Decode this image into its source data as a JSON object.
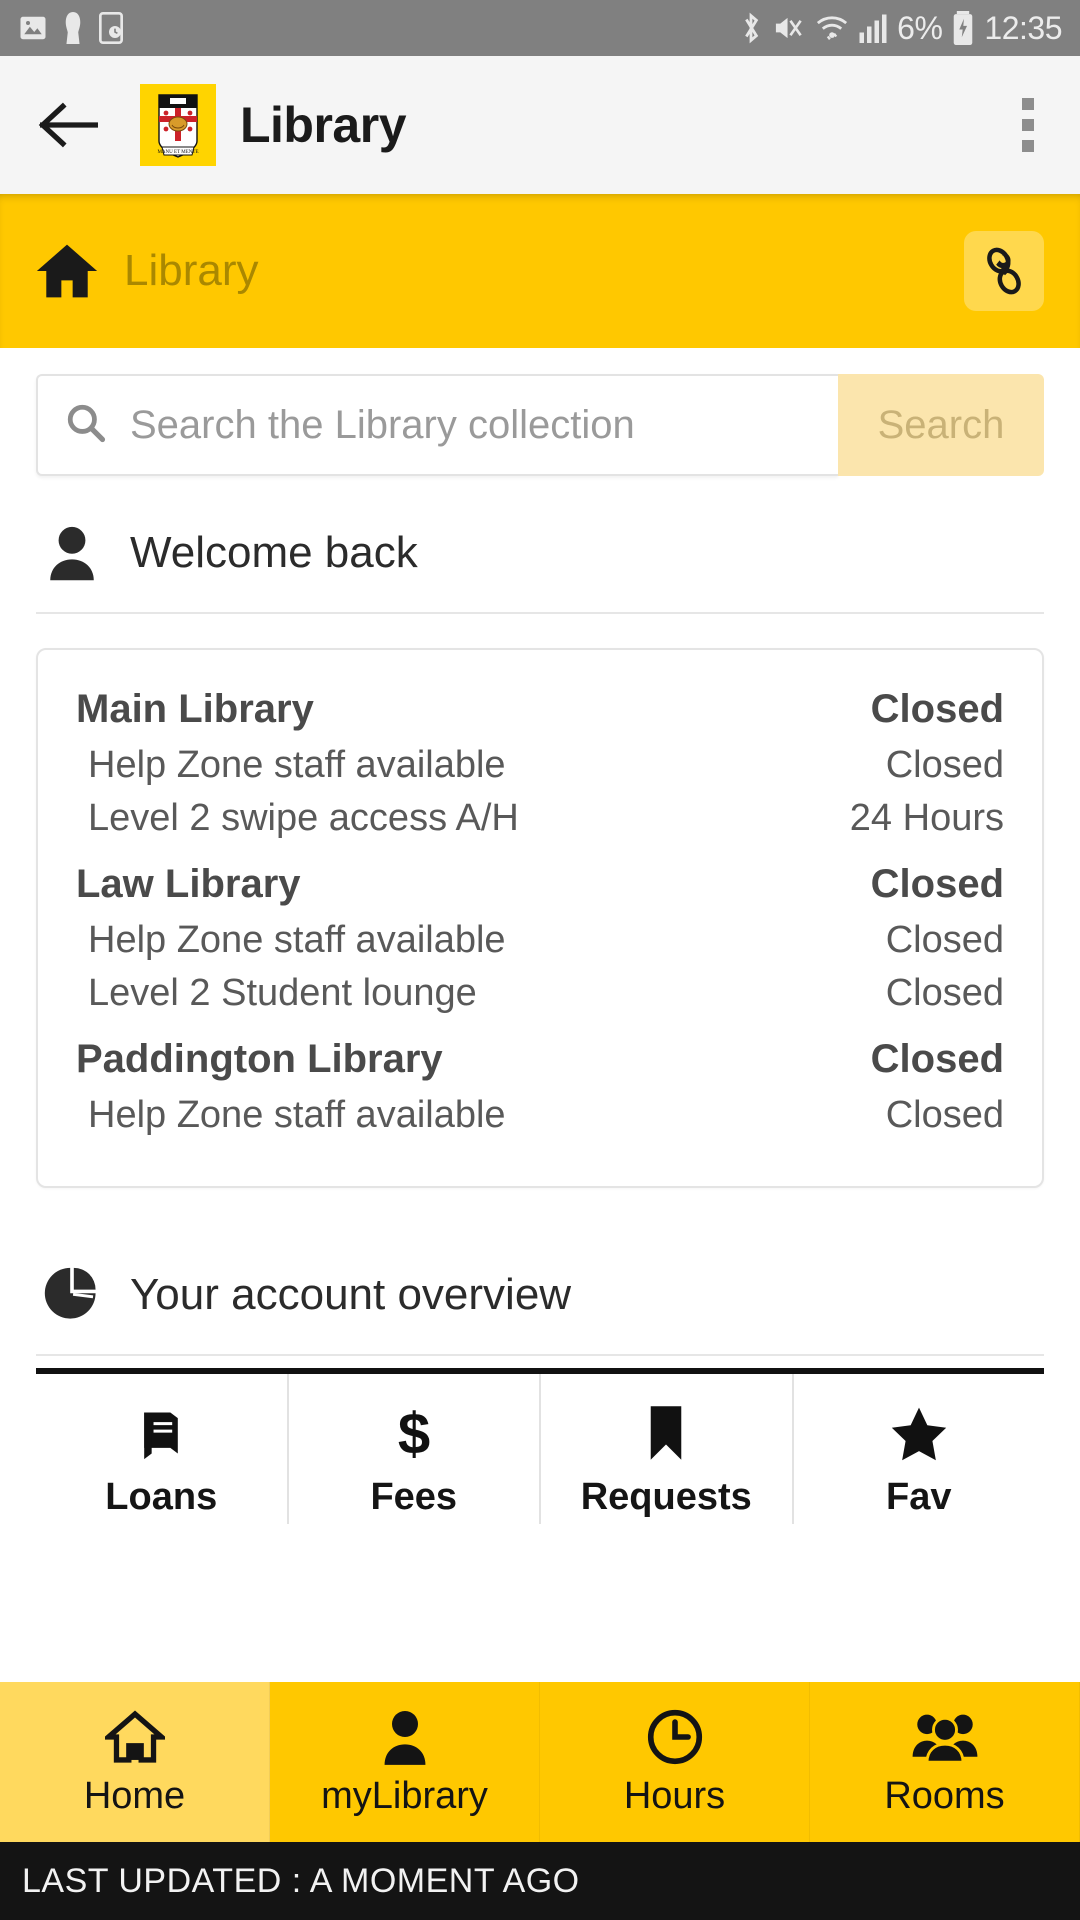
{
  "status_bar": {
    "time": "12:35",
    "battery_percent": "6%",
    "left_icons": [
      "image-icon",
      "person-icon",
      "device-clock-icon"
    ],
    "right_icons": [
      "bluetooth-icon",
      "mute-vibrate-icon",
      "wifi-icon",
      "signal-icon",
      "battery-charging-icon"
    ]
  },
  "appbar": {
    "back_label": "back-arrow",
    "logo_alt": "university-crest",
    "title": "Library",
    "overflow_label": "more-options"
  },
  "breadcrumb": {
    "home_icon": "home-icon",
    "label": "Library",
    "link_button_icon": "chain-link-icon"
  },
  "search": {
    "icon": "search-icon",
    "placeholder": "Search the Library collection",
    "value": "",
    "button_label": "Search"
  },
  "welcome": {
    "icon": "person-icon",
    "title": "Welcome back"
  },
  "hours": {
    "libraries": [
      {
        "name": "Main Library",
        "status": "Closed",
        "details": [
          {
            "label": "Help Zone staff available",
            "value": "Closed"
          },
          {
            "label": "Level 2 swipe access A/H",
            "value": "24 Hours"
          }
        ]
      },
      {
        "name": "Law Library",
        "status": "Closed",
        "details": [
          {
            "label": "Help Zone staff available",
            "value": "Closed"
          },
          {
            "label": "Level 2 Student lounge",
            "value": "Closed"
          }
        ]
      },
      {
        "name": "Paddington Library",
        "status": "Closed",
        "details": [
          {
            "label": "Help Zone staff available",
            "value": "Closed"
          }
        ]
      }
    ]
  },
  "account_overview": {
    "icon": "pie-chart-icon",
    "title": "Your account overview",
    "tiles": [
      {
        "icon": "book-icon",
        "label": "Loans"
      },
      {
        "icon": "dollar-icon",
        "label": "Fees"
      },
      {
        "icon": "bookmark-icon",
        "label": "Requests"
      },
      {
        "icon": "star-icon",
        "label": "Fav"
      }
    ]
  },
  "bottom_nav": {
    "items": [
      {
        "icon": "home-icon",
        "label": "Home",
        "active": true
      },
      {
        "icon": "person-icon",
        "label": "myLibrary",
        "active": false
      },
      {
        "icon": "clock-icon",
        "label": "Hours",
        "active": false
      },
      {
        "icon": "people-icon",
        "label": "Rooms",
        "active": false
      }
    ]
  },
  "footer": {
    "text": "LAST UPDATED : A MOMENT AGO"
  },
  "colors": {
    "brand_yellow": "#ffc800",
    "brand_yellow_light": "#ffd95e",
    "search_button": "#fbe5ad",
    "footer_bg": "#141414",
    "status_bar_bg": "#808080"
  }
}
